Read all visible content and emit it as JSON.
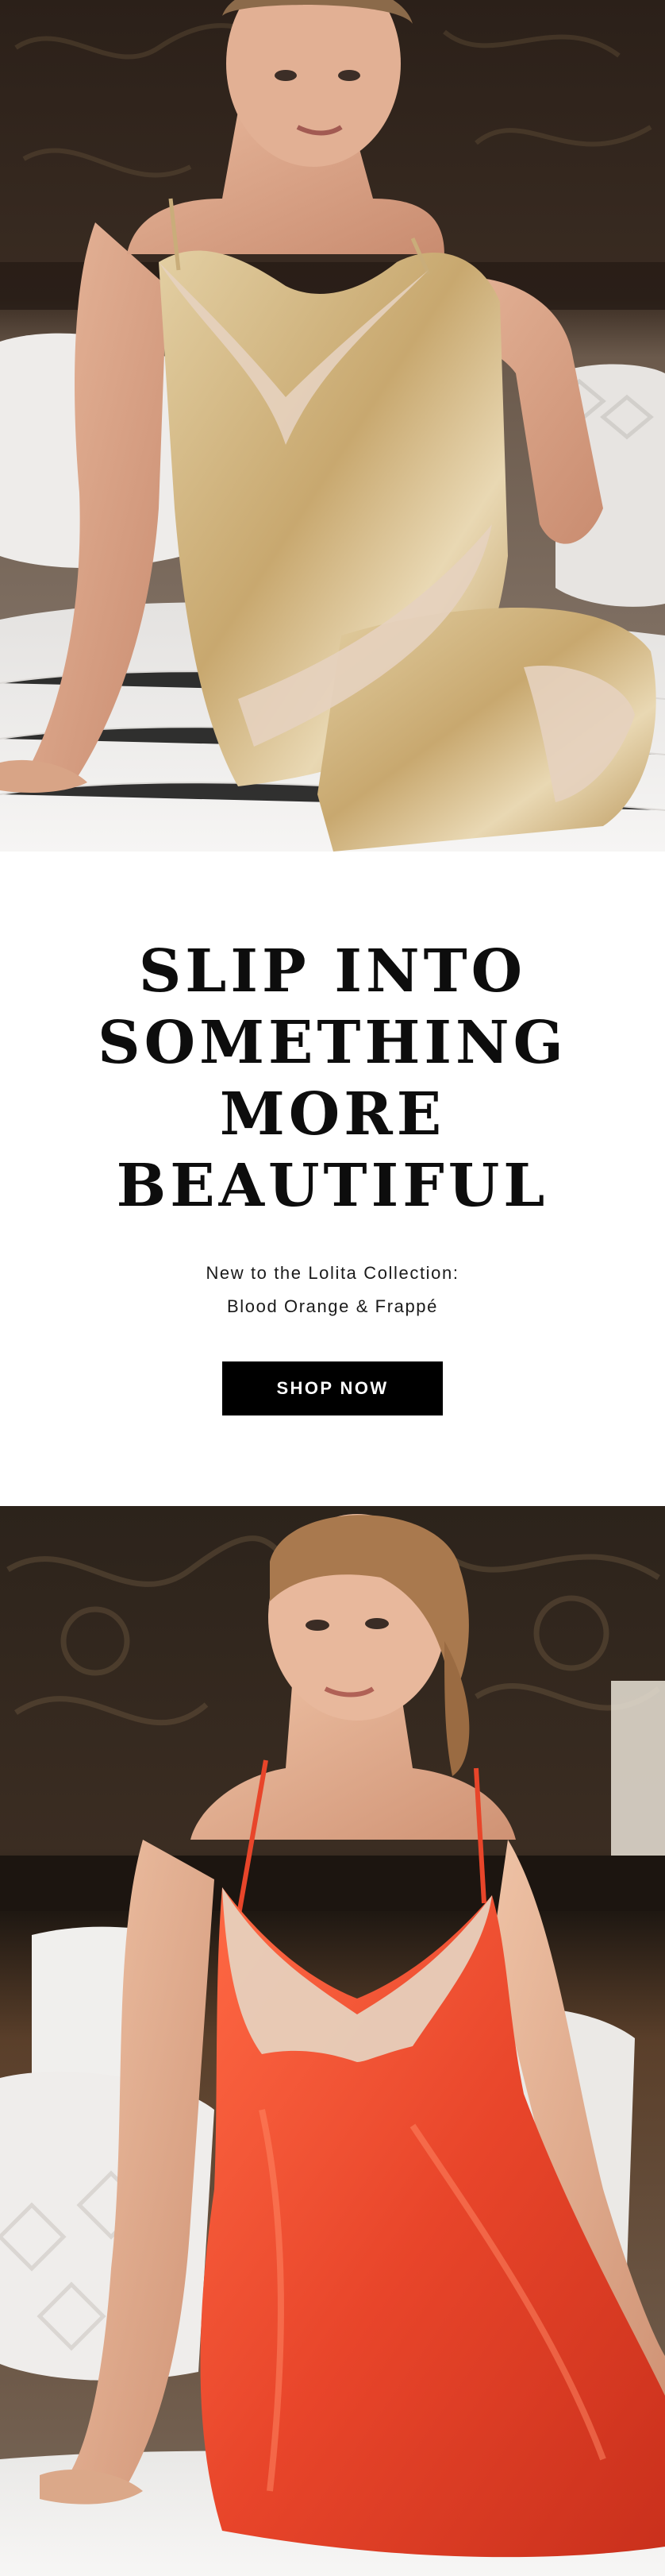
{
  "headline": {
    "line1": "SLIP INTO",
    "line2": "SOMETHING",
    "line3": "MORE",
    "line4": "BEAUTIFUL"
  },
  "subheading": {
    "line1": "New to the Lolita Collection:",
    "line2": "Blood Orange & Frappé"
  },
  "cta": {
    "label": "SHOP NOW"
  },
  "colors": {
    "background": "#ffffff",
    "text": "#0d0d0d",
    "button": "#000000",
    "button_text": "#ffffff",
    "gold_silk": "#c9ad7a",
    "blood_orange_silk": "#e8452a",
    "lace": "#e6d2bf"
  }
}
